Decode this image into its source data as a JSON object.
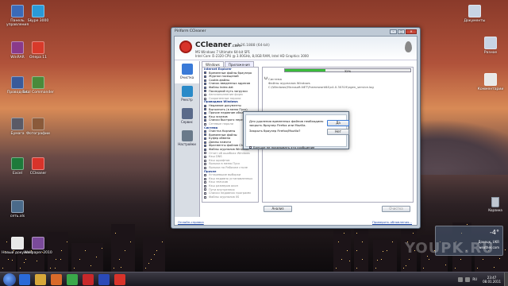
{
  "desktop": {
    "icons_left": [
      {
        "label": "Панель управления",
        "color": "#3a6ab8"
      },
      {
        "label": "Skype 3000",
        "color": "#2a9ad8"
      },
      {
        "label": "WinRAR",
        "color": "#8a3a8a"
      },
      {
        "label": "Опера 11",
        "color": "#d83a2a"
      },
      {
        "label": "Проводник",
        "color": "#3a5a9a"
      },
      {
        "label": "Total Commander",
        "color": "#4a8a3a"
      },
      {
        "label": "Бумага",
        "color": "#5a5a66"
      },
      {
        "label": "Фотографии",
        "color": "#8a5a3a"
      },
      {
        "label": "Excel",
        "color": "#1d7a3a"
      },
      {
        "label": "CCleaner",
        "color": "#d8332a"
      },
      {
        "label": "сеть.xls",
        "color": "#4a6a8a"
      },
      {
        "label": "Новый документ",
        "color": "#e8e8e8"
      },
      {
        "label": "Wallpaper 2010",
        "color": "#7a4a9a"
      }
    ],
    "icons_right": [
      {
        "label": "Документы",
        "color": "#c8d4e4"
      },
      {
        "label": "Разное",
        "color": "#c8d4e4"
      },
      {
        "label": "Комментарии",
        "color": "#e8e8e8"
      }
    ],
    "recycle_bin_label": "Корзина",
    "weather": {
      "temp": "-4°",
      "city": "Донецк, UKR",
      "site": "weather.com"
    },
    "watermark": "YOUPK.RU"
  },
  "window": {
    "title": "Piriform CCleaner",
    "min": "–",
    "max": "□",
    "close": "✕",
    "logo_text": "CCleaner",
    "logo_suffix": ".com",
    "version": "v3.26.1888 (64-bit)",
    "sysinfo": [
      "MS Windows 7 Ultimate 64-bit SP1",
      "Intel Core i5-2320 CPU @ 3.00GHz, 8,0GB RAM, Intel HD Graphics 3000"
    ],
    "sidebar": [
      {
        "label": "Очистка",
        "color": "#3a7ad8",
        "active": true
      },
      {
        "label": "Реестр",
        "color": "#2a8ac8",
        "active": false
      },
      {
        "label": "Сервис",
        "color": "#5a6a8a",
        "active": false
      },
      {
        "label": "Настройки",
        "color": "#6a7a8a",
        "active": false
      }
    ],
    "tabs": [
      "Windows",
      "Приложения"
    ],
    "tree": [
      {
        "text": "Internet Explorer",
        "head": true
      },
      {
        "text": "Временные файлы браузера",
        "on": true
      },
      {
        "text": "Журнал посещений",
        "on": true
      },
      {
        "text": "Cookie-файлы",
        "on": true
      },
      {
        "text": "Список введенных адресов",
        "on": true
      },
      {
        "text": "Файлы Index.dat",
        "on": true
      },
      {
        "text": "Последний путь загрузки",
        "on": true
      },
      {
        "text": "Автозаполнение форм",
        "on": false
      },
      {
        "text": "Сохраненные пароли",
        "on": false
      },
      {
        "text": "Проводник Windows",
        "head": true
      },
      {
        "text": "Недавние документы",
        "on": true
      },
      {
        "text": "Выполнить (в меню Пуск)",
        "on": true
      },
      {
        "text": "Прочие недавние объекты",
        "on": true
      },
      {
        "text": "Кэш эскизов",
        "on": true
      },
      {
        "text": "Списки быстрого перехода",
        "on": true
      },
      {
        "text": "Сетевые пароли",
        "on": false
      },
      {
        "text": "Система",
        "head": true
      },
      {
        "text": "Очистка Корзины",
        "on": true
      },
      {
        "text": "Временные файлы",
        "on": true
      },
      {
        "text": "Буфер обмена",
        "on": true
      },
      {
        "text": "Дампы памяти",
        "on": true
      },
      {
        "text": "Фрагменты файлов Chkdsk",
        "on": true
      },
      {
        "text": "Файлы журналов Windows",
        "on": true
      },
      {
        "text": "Отчет об ошибках Windows",
        "on": false
      },
      {
        "text": "Кэш DNS",
        "on": false
      },
      {
        "text": "Кэш шрифтов",
        "on": false
      },
      {
        "text": "Ярлыки в меню Пуск",
        "on": false
      },
      {
        "text": "Ярлыки на Рабочем столе",
        "on": false
      },
      {
        "text": "Прочее",
        "head": true
      },
      {
        "text": "Устаревшие выборки",
        "on": false
      },
      {
        "text": "Кэш недавно установленных",
        "on": false
      },
      {
        "text": "Кэш значков",
        "on": false
      },
      {
        "text": "Кэш размеров окон",
        "on": false
      },
      {
        "text": "Пути внутренних",
        "on": false
      },
      {
        "text": "Списки недавних программ",
        "on": false
      },
      {
        "text": "Файлы журналов IIS",
        "on": false
      }
    ],
    "progress": {
      "percent": 32,
      "label": "32%"
    },
    "results": [
      "Система",
      "Файлы журналов Windows",
      "C:\\Windows\\Microsoft.NET\\Framework64\\v4.0.30319\\ngen_service.log"
    ],
    "analyze_button": "Анализ",
    "clean_button": "Очистка",
    "online_help": "Онлайн-справка",
    "check_updates": "Проверить обновления..."
  },
  "dialog": {
    "message": "Для удаления временных файлов необходимо закрыть браузер Firefox или Mozilla.",
    "question": "Закрыть браузер Firefox/Mozilla?",
    "yes": "Да",
    "no": "Нет",
    "dont_show": "Больше не показывать это сообщение"
  },
  "taskbar": {
    "apps": [
      {
        "name": "ie",
        "color": "#2a6ad8"
      },
      {
        "name": "explorer",
        "color": "#d8a83a"
      },
      {
        "name": "media",
        "color": "#d86a2a"
      },
      {
        "name": "chrome",
        "color": "#3aa84a"
      },
      {
        "name": "opera",
        "color": "#c8282a"
      },
      {
        "name": "word",
        "color": "#2a4ab8"
      },
      {
        "name": "ccleaner",
        "color": "#d8332a"
      }
    ],
    "lang": "RU",
    "time": "23:47",
    "date": "08.01.2011"
  }
}
